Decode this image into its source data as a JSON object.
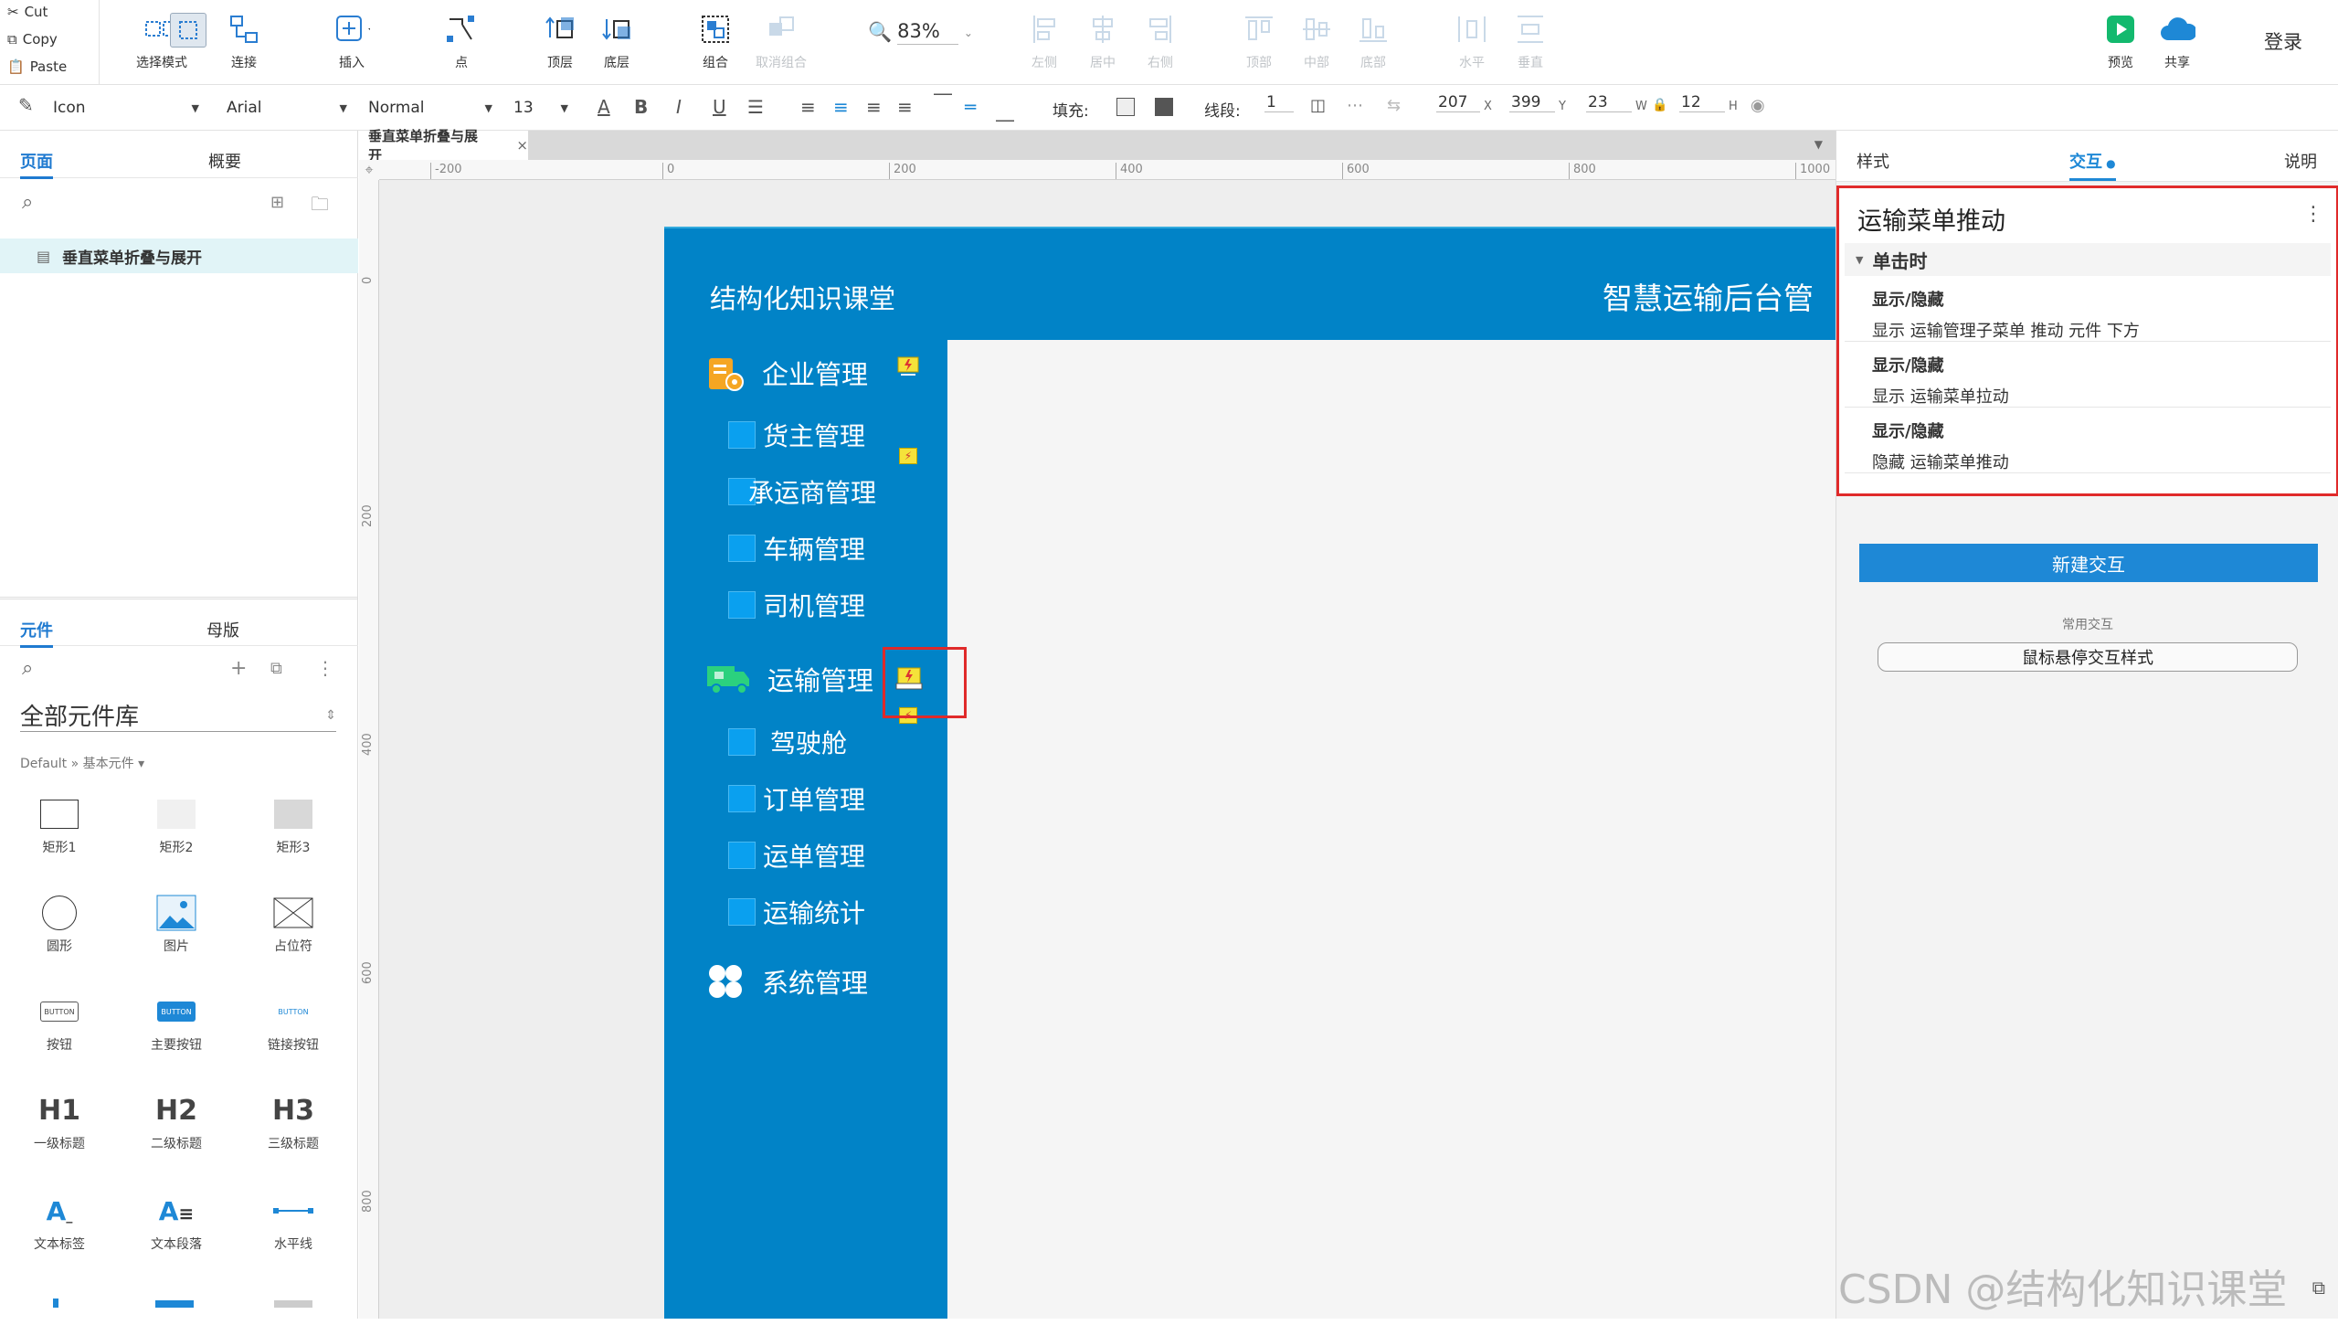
{
  "clipboard": {
    "cut": "Cut",
    "copy": "Copy",
    "paste": "Paste"
  },
  "toolbar": {
    "tools": [
      {
        "label": "选择模式",
        "icon": "select-mode-icon",
        "enabled": true
      },
      {
        "label": "连接",
        "icon": "connect-icon",
        "enabled": true
      },
      {
        "label": "插入",
        "icon": "insert-icon",
        "enabled": true
      },
      {
        "label": "点",
        "icon": "point-icon",
        "enabled": true
      },
      {
        "label": "顶层",
        "icon": "bring-front-icon",
        "enabled": true
      },
      {
        "label": "底层",
        "icon": "send-back-icon",
        "enabled": true
      },
      {
        "label": "组合",
        "icon": "group-icon",
        "enabled": true
      },
      {
        "label": "取消组合",
        "icon": "ungroup-icon",
        "enabled": false
      },
      {
        "label": "左侧",
        "icon": "align-left-icon",
        "enabled": false
      },
      {
        "label": "居中",
        "icon": "align-center-icon",
        "enabled": false
      },
      {
        "label": "右侧",
        "icon": "align-right-icon",
        "enabled": false
      },
      {
        "label": "顶部",
        "icon": "align-top-icon",
        "enabled": false
      },
      {
        "label": "中部",
        "icon": "align-middle-icon",
        "enabled": false
      },
      {
        "label": "底部",
        "icon": "align-bottom-icon",
        "enabled": false
      },
      {
        "label": "水平",
        "icon": "distribute-h-icon",
        "enabled": false
      },
      {
        "label": "垂直",
        "icon": "distribute-v-icon",
        "enabled": false
      }
    ],
    "zoom": "83%",
    "preview": "预览",
    "share": "共享",
    "login": "登录"
  },
  "format": {
    "style": "Icon",
    "font": "Arial",
    "weight": "Normal",
    "size": "13",
    "fill_label": "填充:",
    "stroke_label": "线段:",
    "stroke_value": "1",
    "x": "207",
    "x_unit": "X",
    "y": "399",
    "y_unit": "Y",
    "w": "23",
    "w_unit": "W",
    "h": "12",
    "h_unit": "H"
  },
  "left": {
    "tab_pages": "页面",
    "tab_outline": "概要",
    "page_item": "垂直菜单折叠与展开",
    "tab_widgets": "元件",
    "tab_masters": "母版",
    "library": "全部元件库",
    "breadcrumb": "Default » 基本元件 ▾",
    "widgets": [
      {
        "label": "矩形1",
        "icon": "rect1-icon"
      },
      {
        "label": "矩形2",
        "icon": "rect2-icon"
      },
      {
        "label": "矩形3",
        "icon": "rect3-icon"
      },
      {
        "label": "圆形",
        "icon": "circle-icon"
      },
      {
        "label": "图片",
        "icon": "image-icon"
      },
      {
        "label": "占位符",
        "icon": "placeholder-icon"
      },
      {
        "label": "按钮",
        "icon": "button-icon"
      },
      {
        "label": "主要按钮",
        "icon": "primary-button-icon"
      },
      {
        "label": "链接按钮",
        "icon": "link-button-icon"
      },
      {
        "label": "一级标题",
        "icon": "h1-icon"
      },
      {
        "label": "二级标题",
        "icon": "h2-icon"
      },
      {
        "label": "三级标题",
        "icon": "h3-icon"
      },
      {
        "label": "文本标签",
        "icon": "text-label-icon"
      },
      {
        "label": "文本段落",
        "icon": "text-paragraph-icon"
      },
      {
        "label": "水平线",
        "icon": "hline-icon"
      }
    ],
    "button_text": "BUTTON",
    "h1": "H1",
    "h2": "H2",
    "h3": "H3"
  },
  "canvas": {
    "doc_tab": "垂直菜单折叠与展开",
    "ruler_h": [
      "-200",
      "0",
      "200",
      "400",
      "600",
      "800",
      "1000"
    ],
    "ruler_v": [
      "0",
      "200",
      "400",
      "600",
      "800"
    ],
    "brand": "结构化知识课堂",
    "system_title": "智慧运输后台管",
    "menu": {
      "enterprise": "企业管理",
      "enterprise_items": [
        "货主管理",
        "承运商管理",
        "车辆管理",
        "司机管理"
      ],
      "transport": "运输管理",
      "transport_items": [
        "驾驶舱",
        "订单管理",
        "运单管理",
        "运输统计"
      ],
      "system": "系统管理"
    },
    "colors": {
      "header": "#0183c7",
      "accent": "#0aa0ef"
    }
  },
  "right": {
    "tab_style": "样式",
    "tab_interaction": "交互",
    "tab_notes": "说明",
    "widget_name": "运输菜单推动",
    "event": "单击时",
    "actions": [
      {
        "title": "显示/隐藏",
        "desc": "显示 运输管理子菜单 推动 元件 下方"
      },
      {
        "title": "显示/隐藏",
        "desc": "显示 运输菜单拉动"
      },
      {
        "title": "显示/隐藏",
        "desc": "隐藏 运输菜单推动"
      }
    ],
    "new_interaction": "新建交互",
    "common_label": "常用交互",
    "hover_style": "鼠标悬停交互样式"
  },
  "watermark": "CSDN @结构化知识课堂"
}
